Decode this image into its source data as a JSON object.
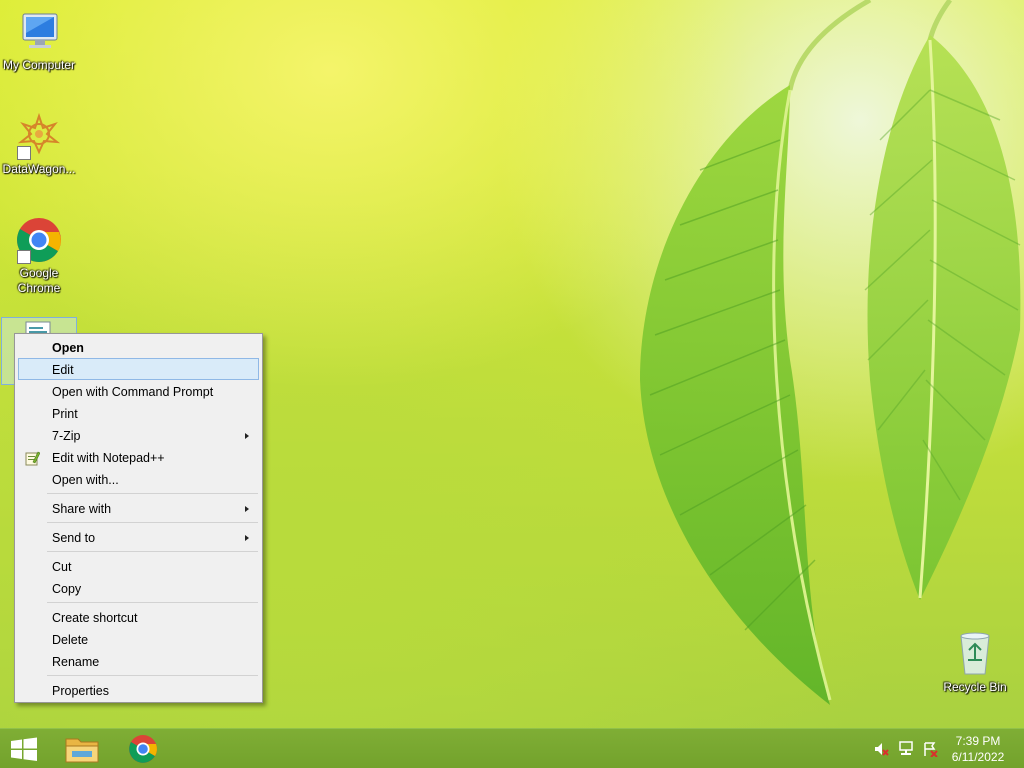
{
  "desktop": {
    "icons": [
      {
        "label": "My Computer",
        "icon": "computer-icon"
      },
      {
        "label": "DataWagon...",
        "icon": "datawagon-icon"
      },
      {
        "label": "Google Chrome",
        "icon": "chrome-icon"
      },
      {
        "label": "Recycle Bin",
        "icon": "recycle-bin-icon"
      }
    ],
    "selected_file_icon": "text-file-icon"
  },
  "context_menu": {
    "items": [
      {
        "label": "Open",
        "bold": true
      },
      {
        "label": "Edit",
        "highlighted": true
      },
      {
        "label": "Open with Command Prompt"
      },
      {
        "label": "Print"
      },
      {
        "label": "7-Zip",
        "submenu": true
      },
      {
        "label": "Edit with Notepad++",
        "icon": "notepad-plus-plus-icon"
      },
      {
        "label": "Open with..."
      },
      {
        "label": "Share with",
        "submenu": true
      },
      {
        "label": "Send to",
        "submenu": true
      },
      {
        "label": "Cut"
      },
      {
        "label": "Copy"
      },
      {
        "label": "Create shortcut"
      },
      {
        "label": "Delete"
      },
      {
        "label": "Rename"
      },
      {
        "label": "Properties"
      }
    ]
  },
  "taskbar": {
    "apps": [
      {
        "name": "start",
        "icon": "windows-logo-icon"
      },
      {
        "name": "file-explorer",
        "icon": "folder-icon"
      },
      {
        "name": "chrome",
        "icon": "chrome-icon"
      }
    ],
    "tray": {
      "icons": [
        "volume-muted-icon",
        "network-icon",
        "action-center-icon"
      ],
      "time": "7:39 PM",
      "date": "6/11/2022"
    }
  },
  "colors": {
    "menu_highlight": "#d9ebf9",
    "taskbar": "#7aa932"
  }
}
